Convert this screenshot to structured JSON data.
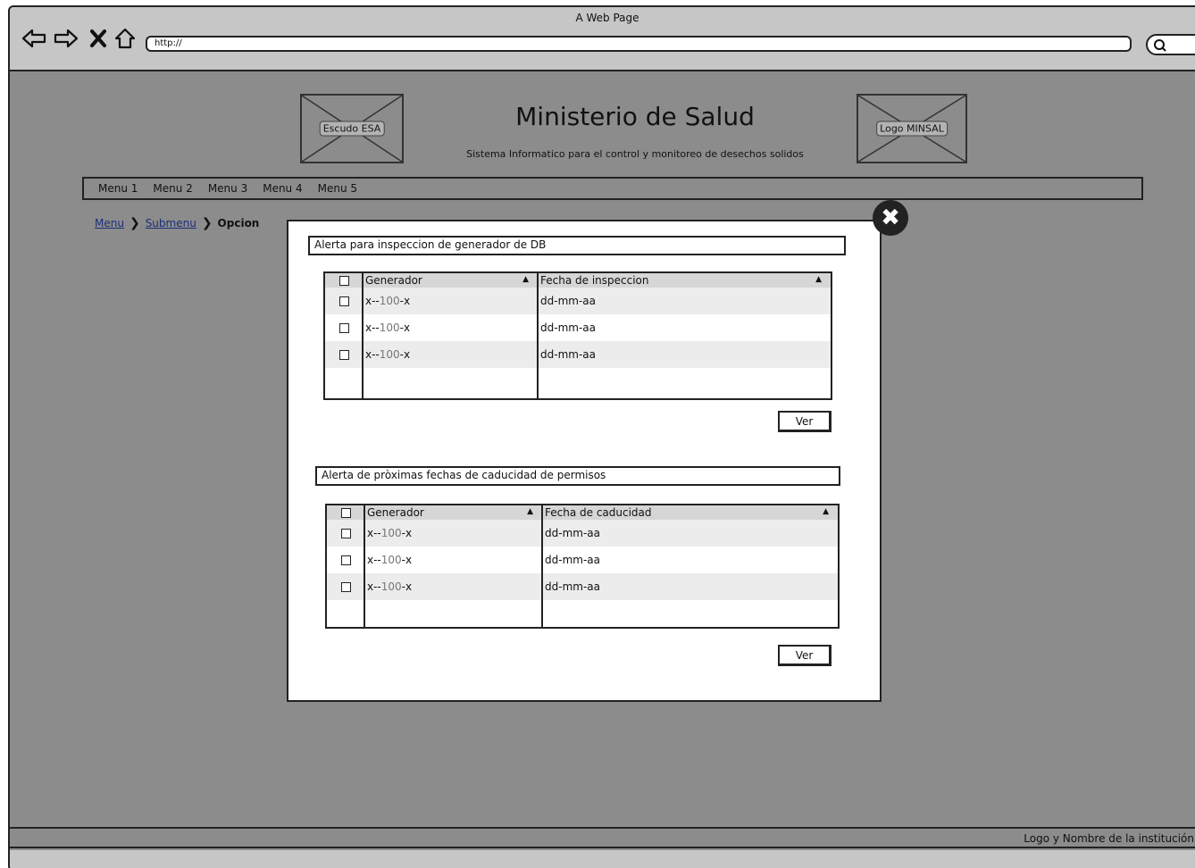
{
  "window": {
    "title": "A Web Page"
  },
  "address_bar": {
    "url": "http://"
  },
  "header": {
    "left_logo_label": "Escudo ESA",
    "right_logo_label": "Logo MINSAL",
    "title": "Ministerio de Salud",
    "subtitle": "Sistema Informatico para el control y monitoreo de desechos solidos"
  },
  "menu": {
    "items": [
      "Menu 1",
      "Menu 2",
      "Menu 3",
      "Menu 4",
      "Menu 5"
    ]
  },
  "breadcrumb": {
    "menu": "Menu",
    "submenu": "Submenu",
    "current": "Opcion"
  },
  "modal": {
    "section1": {
      "title": "Alerta para inspeccion de generador de DB",
      "col1": "Generador",
      "col2": "Fecha de inspeccion",
      "rows": [
        {
          "prefix": "x--",
          "num": "100",
          "suffix": "-x",
          "date": "dd-mm-aa"
        },
        {
          "prefix": "x--",
          "num": "100",
          "suffix": "-x",
          "date": "dd-mm-aa"
        },
        {
          "prefix": "x--",
          "num": "100",
          "suffix": "-x",
          "date": "dd-mm-aa"
        }
      ],
      "button": "Ver"
    },
    "section2": {
      "title": "Alerta de pròximas fechas de caducidad de permisos",
      "col1": "Generador",
      "col2": "Fecha de caducidad",
      "rows": [
        {
          "prefix": "x--",
          "num": "100",
          "suffix": "-x",
          "date": "dd-mm-aa"
        },
        {
          "prefix": "x--",
          "num": "100",
          "suffix": "-x",
          "date": "dd-mm-aa"
        },
        {
          "prefix": "x--",
          "num": "100",
          "suffix": "-x",
          "date": "dd-mm-aa"
        }
      ],
      "button": "Ver"
    }
  },
  "footer": {
    "text": "Logo y Nombre de la institución"
  },
  "icons": {
    "back": "arrow-left-icon",
    "forward": "arrow-right-icon",
    "stop": "close-icon",
    "home": "home-icon",
    "search": "search-icon",
    "close_modal": "close-circle-icon"
  }
}
